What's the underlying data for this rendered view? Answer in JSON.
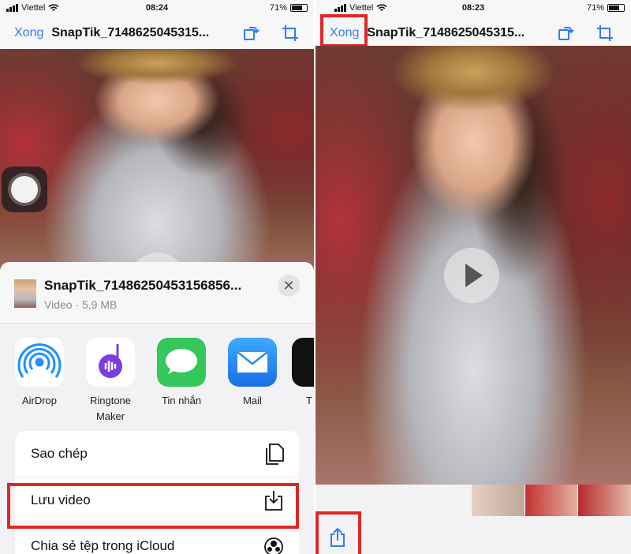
{
  "left": {
    "status": {
      "carrier": "Viettel",
      "time": "08:24",
      "battery": "71%"
    },
    "navbar": {
      "done": "Xong",
      "title": "SnapTik_7148625045315..."
    },
    "sheet": {
      "title": "SnapTik_71486250453156856...",
      "subtitle": "Video · 5,9 MB",
      "close": "✕",
      "apps": [
        {
          "label": "AirDrop",
          "icon": "airdrop-icon"
        },
        {
          "label": "Ringtone Maker",
          "icon": "ringtone-maker-icon"
        },
        {
          "label": "Tin nhắn",
          "icon": "messages-icon"
        },
        {
          "label": "Mail",
          "icon": "mail-icon"
        },
        {
          "label": "T",
          "icon": "tiktok-icon"
        }
      ],
      "actions": [
        {
          "label": "Sao chép",
          "icon": "copy-icon"
        },
        {
          "label": "Lưu video",
          "icon": "save-to-device-icon"
        },
        {
          "label": "Chia sẻ tệp trong iCloud",
          "icon": "icloud-share-icon"
        }
      ]
    }
  },
  "right": {
    "status": {
      "carrier": "Viettel",
      "time": "08:23",
      "battery": "71%"
    },
    "navbar": {
      "done": "Xong",
      "title": "SnapTik_7148625045315..."
    }
  },
  "colors": {
    "accent": "#2f7cf6",
    "highlight": "#e02727",
    "messages": "#34c759",
    "mail": "#2a8cf2"
  }
}
